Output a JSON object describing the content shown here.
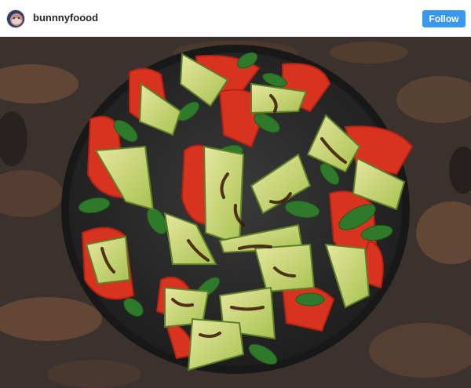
{
  "header": {
    "username": "bunnnyfoood",
    "avatar_icon": "profile-avatar",
    "follow_label": "Follow"
  },
  "colors": {
    "follow_button": "#3897f0",
    "username_text": "#262626",
    "plate": "#2b2b2b",
    "countertop": "#3a3330"
  },
  "post": {
    "image_subject": "salad-photo"
  }
}
